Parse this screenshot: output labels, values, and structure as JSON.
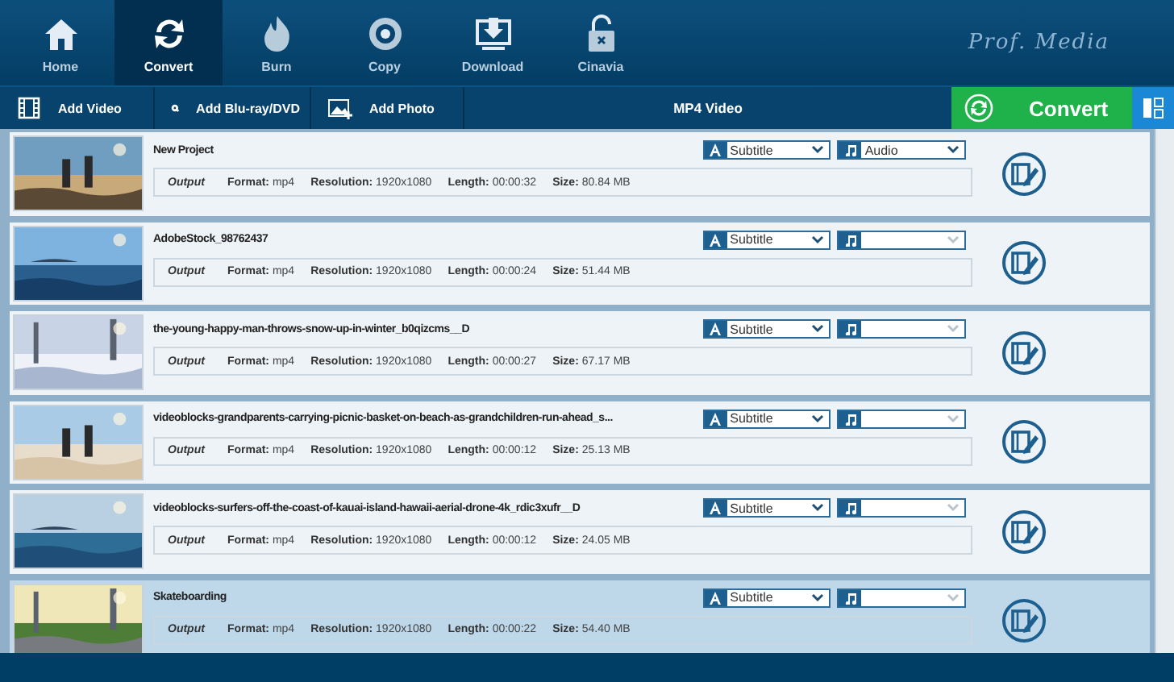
{
  "nav": {
    "items": [
      {
        "label": "Home",
        "selected": false
      },
      {
        "label": "Convert",
        "selected": true
      },
      {
        "label": "Burn",
        "selected": false
      },
      {
        "label": "Copy",
        "selected": false
      },
      {
        "label": "Download",
        "selected": false
      },
      {
        "label": "Cinavia",
        "selected": false
      }
    ],
    "logo": "Prof. Media"
  },
  "toolbar": {
    "buttons": [
      {
        "label": "Add Video"
      },
      {
        "label": "Add Blu-ray/DVD"
      },
      {
        "label": "Add Photo"
      }
    ],
    "profile": "MP4 Video",
    "convert": "Convert"
  },
  "rows": [
    {
      "name": "New Project",
      "selected": false,
      "subtitle": "Subtitle",
      "audio": {
        "value": "Audio",
        "disabled": false
      },
      "output": {
        "label": "Output",
        "fields": [
          {
            "label": "Format:",
            "value": "mp4"
          },
          {
            "label": "Resolution:",
            "value": "1920x1080"
          },
          {
            "label": "Length:",
            "value": "00:00:32"
          },
          {
            "label": "Size:",
            "value": "80.84 MB"
          }
        ]
      }
    },
    {
      "name": "AdobeStock_98762437",
      "selected": false,
      "subtitle": "Subtitle",
      "audio": {
        "disabled": true
      },
      "output": {
        "label": "Output",
        "fields": [
          {
            "label": "Format:",
            "value": "mp4"
          },
          {
            "label": "Resolution:",
            "value": "1920x1080"
          },
          {
            "label": "Length:",
            "value": "00:00:24"
          },
          {
            "label": "Size:",
            "value": "51.44 MB"
          }
        ]
      }
    },
    {
      "name": "the-young-happy-man-throws-snow-up-in-winter_b0qizcms__D",
      "selected": false,
      "subtitle": "Subtitle",
      "audio": {
        "disabled": true
      },
      "output": {
        "label": "Output",
        "fields": [
          {
            "label": "Format:",
            "value": "mp4"
          },
          {
            "label": "Resolution:",
            "value": "1920x1080"
          },
          {
            "label": "Length:",
            "value": "00:00:27"
          },
          {
            "label": "Size:",
            "value": "67.17 MB"
          }
        ]
      }
    },
    {
      "name": "videoblocks-grandparents-carrying-picnic-basket-on-beach-as-grandchildren-run-ahead_s...",
      "selected": false,
      "subtitle": "Subtitle",
      "audio": {
        "disabled": true
      },
      "output": {
        "label": "Output",
        "fields": [
          {
            "label": "Format:",
            "value": "mp4"
          },
          {
            "label": "Resolution:",
            "value": "1920x1080"
          },
          {
            "label": "Length:",
            "value": "00:00:12"
          },
          {
            "label": "Size:",
            "value": "25.13 MB"
          }
        ]
      }
    },
    {
      "name": "videoblocks-surfers-off-the-coast-of-kauai-island-hawaii-aerial-drone-4k_rdic3xufr__D",
      "selected": false,
      "subtitle": "Subtitle",
      "audio": {
        "disabled": true
      },
      "output": {
        "label": "Output",
        "fields": [
          {
            "label": "Format:",
            "value": "mp4"
          },
          {
            "label": "Resolution:",
            "value": "1920x1080"
          },
          {
            "label": "Length:",
            "value": "00:00:12"
          },
          {
            "label": "Size:",
            "value": "24.05 MB"
          }
        ]
      }
    },
    {
      "name": "Skateboarding",
      "selected": true,
      "subtitle": "Subtitle",
      "audio": {
        "disabled": true
      },
      "output": {
        "label": "Output",
        "fields": [
          {
            "label": "Format:",
            "value": "mp4"
          },
          {
            "label": "Resolution:",
            "value": "1920x1080"
          },
          {
            "label": "Length:",
            "value": "00:00:22"
          },
          {
            "label": "Size:",
            "value": "54.40 MB"
          }
        ]
      }
    }
  ]
}
